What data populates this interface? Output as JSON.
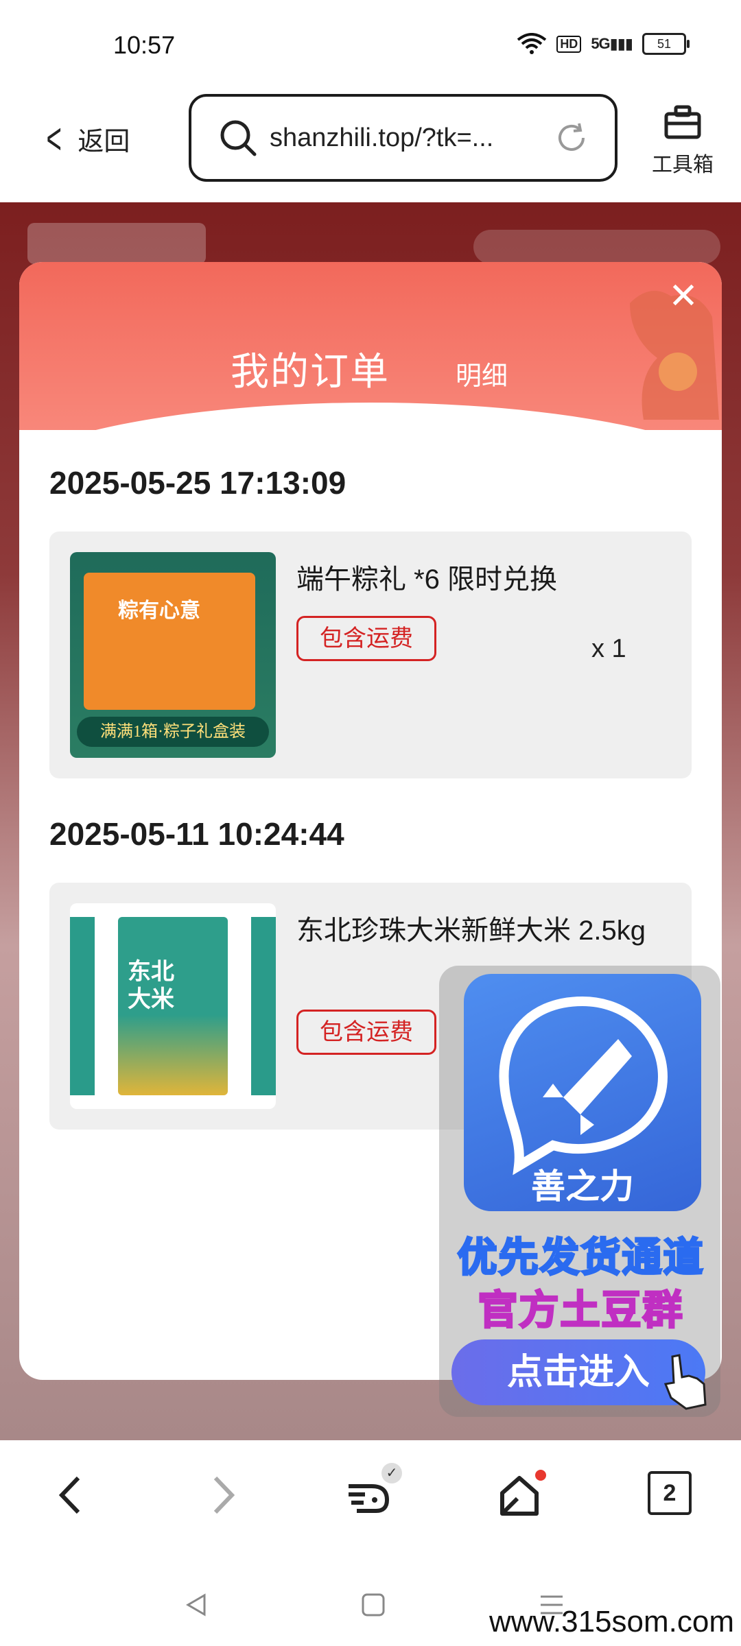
{
  "status_bar": {
    "time": "10:57",
    "network": "5G",
    "hd": "HD",
    "battery": "51"
  },
  "browser": {
    "back_label": "返回",
    "url": "shanzhili.top/?tk=...",
    "toolbox_label": "工具箱"
  },
  "modal": {
    "title": "我的订单",
    "detail_link": "明细",
    "close_symbol": "✕",
    "orders": [
      {
        "date": "2025-05-25 17:13:09",
        "product": "端午粽礼 *6 限时兑换",
        "tag": "包含运费",
        "quantity": "x 1",
        "thumb_text": "满满1箱·粽子礼盒装",
        "thumb_title": "粽有心意"
      },
      {
        "date": "2025-05-11 10:24:44",
        "product": "东北珍珠大米新鲜大米 2.5kg",
        "tag": "包含运费",
        "thumb_text": "东北大米"
      }
    ]
  },
  "promo": {
    "brand": "善之力",
    "line1": "优先发货通道",
    "line2": "官方土豆群",
    "button": "点击进入"
  },
  "bottom_nav": {
    "tab_count": "2"
  },
  "watermark": "www.315som.com",
  "colors": {
    "header_red": "#f2695b",
    "tag_red": "#d42323",
    "promo_blue": "#3566d8"
  }
}
